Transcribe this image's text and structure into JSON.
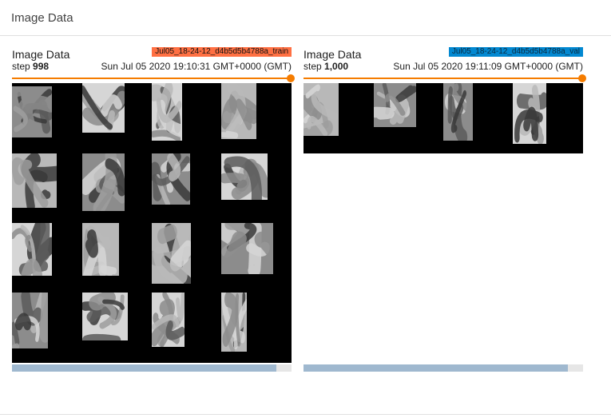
{
  "section": {
    "title": "Image Data"
  },
  "cards": {
    "train": {
      "run": "Jul05_18-24-12_d4b5d5b4788a_train",
      "title": "Image Data",
      "step_label": "step",
      "step_value": "998",
      "timestamp": "Sun Jul 05 2020 19:10:31 GMT+0000 (GMT)"
    },
    "val": {
      "run": "Jul05_18-24-12_d4b5d5b4788a_val",
      "title": "Image Data",
      "step_label": "step",
      "step_value": "1,000",
      "timestamp": "Sun Jul 05 2020 19:11:09 GMT+0000 (GMT)"
    }
  },
  "colors": {
    "train_run": "#ff7043",
    "val_run": "#0288d1",
    "slider": "#f57c00",
    "scroll_thumb": "#9fb8cf"
  },
  "slider_fraction": {
    "train": 1.0,
    "val": 1.0
  }
}
